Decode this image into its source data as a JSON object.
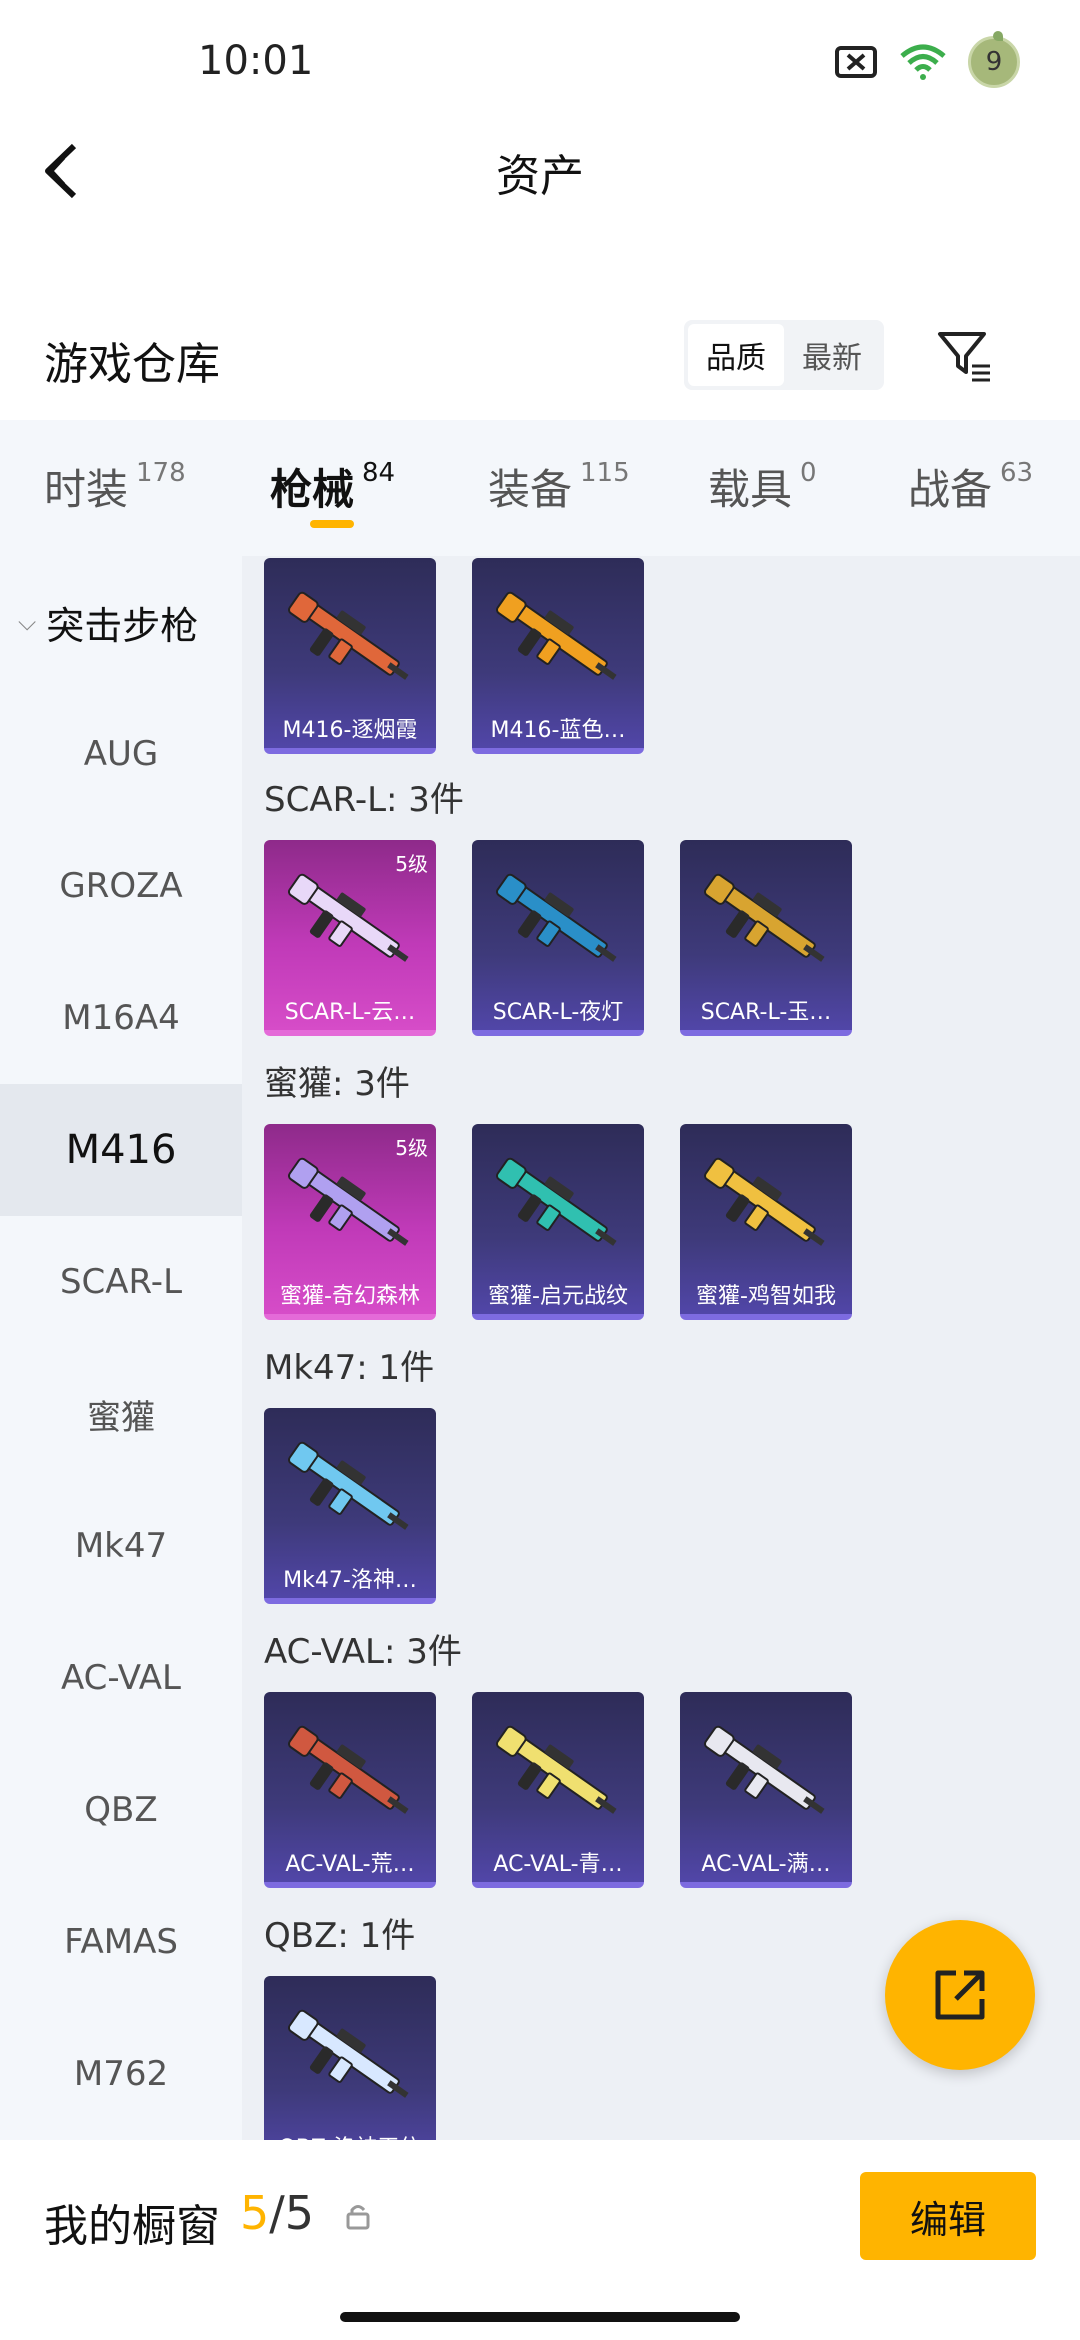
{
  "status_bar": {
    "time": "10:01",
    "battery_level": "9",
    "icons": [
      "sim-off-icon",
      "wifi-icon",
      "battery-icon"
    ]
  },
  "nav": {
    "title": "资产",
    "back_icon": "back-chevron-icon"
  },
  "header": {
    "title": "游戏仓库",
    "sort_options": [
      "品质",
      "最新"
    ],
    "sort_selected": "品质",
    "filter_icon": "filter-icon"
  },
  "categories": [
    {
      "name": "时装",
      "count": "178"
    },
    {
      "name": "枪械",
      "count": "84"
    },
    {
      "name": "装备",
      "count": "115"
    },
    {
      "name": "载具",
      "count": "0"
    },
    {
      "name": "战备",
      "count": "63"
    }
  ],
  "active_category": "枪械",
  "sidebar": {
    "group": "突击步枪",
    "items": [
      "AUG",
      "GROZA",
      "M16A4",
      "M416",
      "SCAR-L",
      "蜜獾",
      "Mk47",
      "AC-VAL",
      "QBZ",
      "FAMAS",
      "M762"
    ],
    "selected": "M416"
  },
  "sections": [
    {
      "label": "",
      "items": [
        {
          "name": "M416-逐烟霞",
          "level": "",
          "quality": "purple"
        },
        {
          "name": "M416-蓝色…",
          "level": "",
          "quality": "purple"
        }
      ]
    },
    {
      "label": "SCAR-L: 3件",
      "items": [
        {
          "name": "SCAR-L-云…",
          "level": "5级",
          "quality": "pink"
        },
        {
          "name": "SCAR-L-夜灯",
          "level": "",
          "quality": "purple"
        },
        {
          "name": "SCAR-L-玉…",
          "level": "",
          "quality": "purple"
        }
      ]
    },
    {
      "label": "蜜獾: 3件",
      "items": [
        {
          "name": "蜜獾-奇幻森林",
          "level": "5级",
          "quality": "pink"
        },
        {
          "name": "蜜獾-启元战纹",
          "level": "",
          "quality": "purple"
        },
        {
          "name": "蜜獾-鸡智如我",
          "level": "",
          "quality": "purple"
        }
      ]
    },
    {
      "label": "Mk47: 1件",
      "items": [
        {
          "name": "Mk47-洛神…",
          "level": "",
          "quality": "purple"
        }
      ]
    },
    {
      "label": "AC-VAL: 3件",
      "items": [
        {
          "name": "AC-VAL-荒…",
          "level": "",
          "quality": "purple"
        },
        {
          "name": "AC-VAL-青…",
          "level": "",
          "quality": "purple"
        },
        {
          "name": "AC-VAL-满…",
          "level": "",
          "quality": "purple"
        }
      ]
    },
    {
      "label": "QBZ: 1件",
      "items": [
        {
          "name": "QBZ-洛神天依",
          "level": "",
          "quality": "purple"
        }
      ]
    }
  ],
  "gun_colors": [
    "#e0673a",
    "#f0a020",
    "#e8d8f8",
    "#2a8fc8",
    "#d8a430",
    "#b0a0f0",
    "#30c0b0",
    "#f0c040",
    "#70c8f0",
    "#d05840",
    "#f0e070",
    "#e8e8f0",
    "#d8e8ff"
  ],
  "fab_icon": "share-icon",
  "bottom_bar": {
    "label": "我的橱窗",
    "current": "5",
    "separator": "/",
    "max": "5",
    "lock_icon": "lock-icon",
    "edit_label": "编辑"
  }
}
